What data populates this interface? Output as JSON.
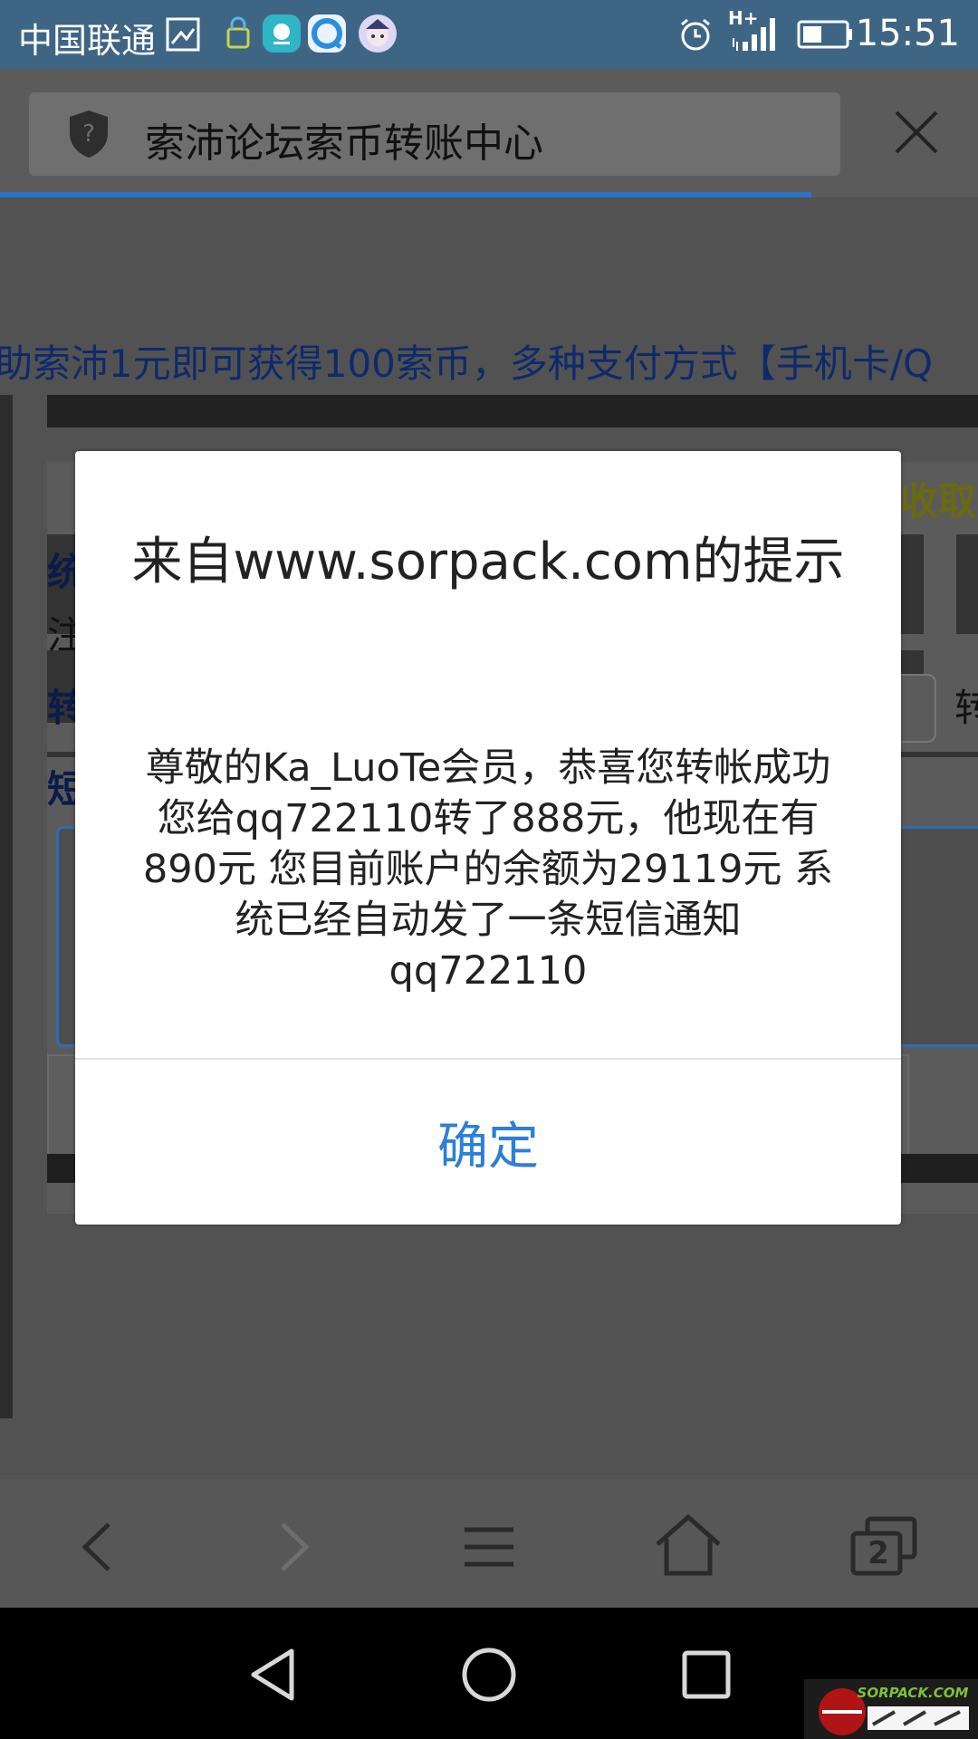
{
  "status_bar": {
    "carrier": "中国联通",
    "time": "15:51",
    "network": "H+"
  },
  "browser": {
    "page_title": "索沛论坛索币转账中心",
    "tabs_count": "2",
    "load_progress": 0.83
  },
  "page": {
    "marquee": "助索沛1元即可获得100索币，多种支付方式【手机卡/Q",
    "right_text": "收取",
    "fragments": [
      "统",
      "注",
      "转",
      "短",
      "转"
    ]
  },
  "dialog": {
    "title": "来自www.sorpack.com的提示",
    "message": "尊敬的Ka_LuoTe会员，恭喜您转帐成功  您给qq722110转了888元，他现在有890元  您目前账户的余额为29119元  系统已经自动发了一条短信通知qq722110",
    "ok_label": "确定"
  },
  "watermark": {
    "text": "SORPACK.COM"
  },
  "colors": {
    "status_bar": "#3f6585",
    "accent_blue": "#2d7fd6",
    "progress": "#2b73c7"
  }
}
